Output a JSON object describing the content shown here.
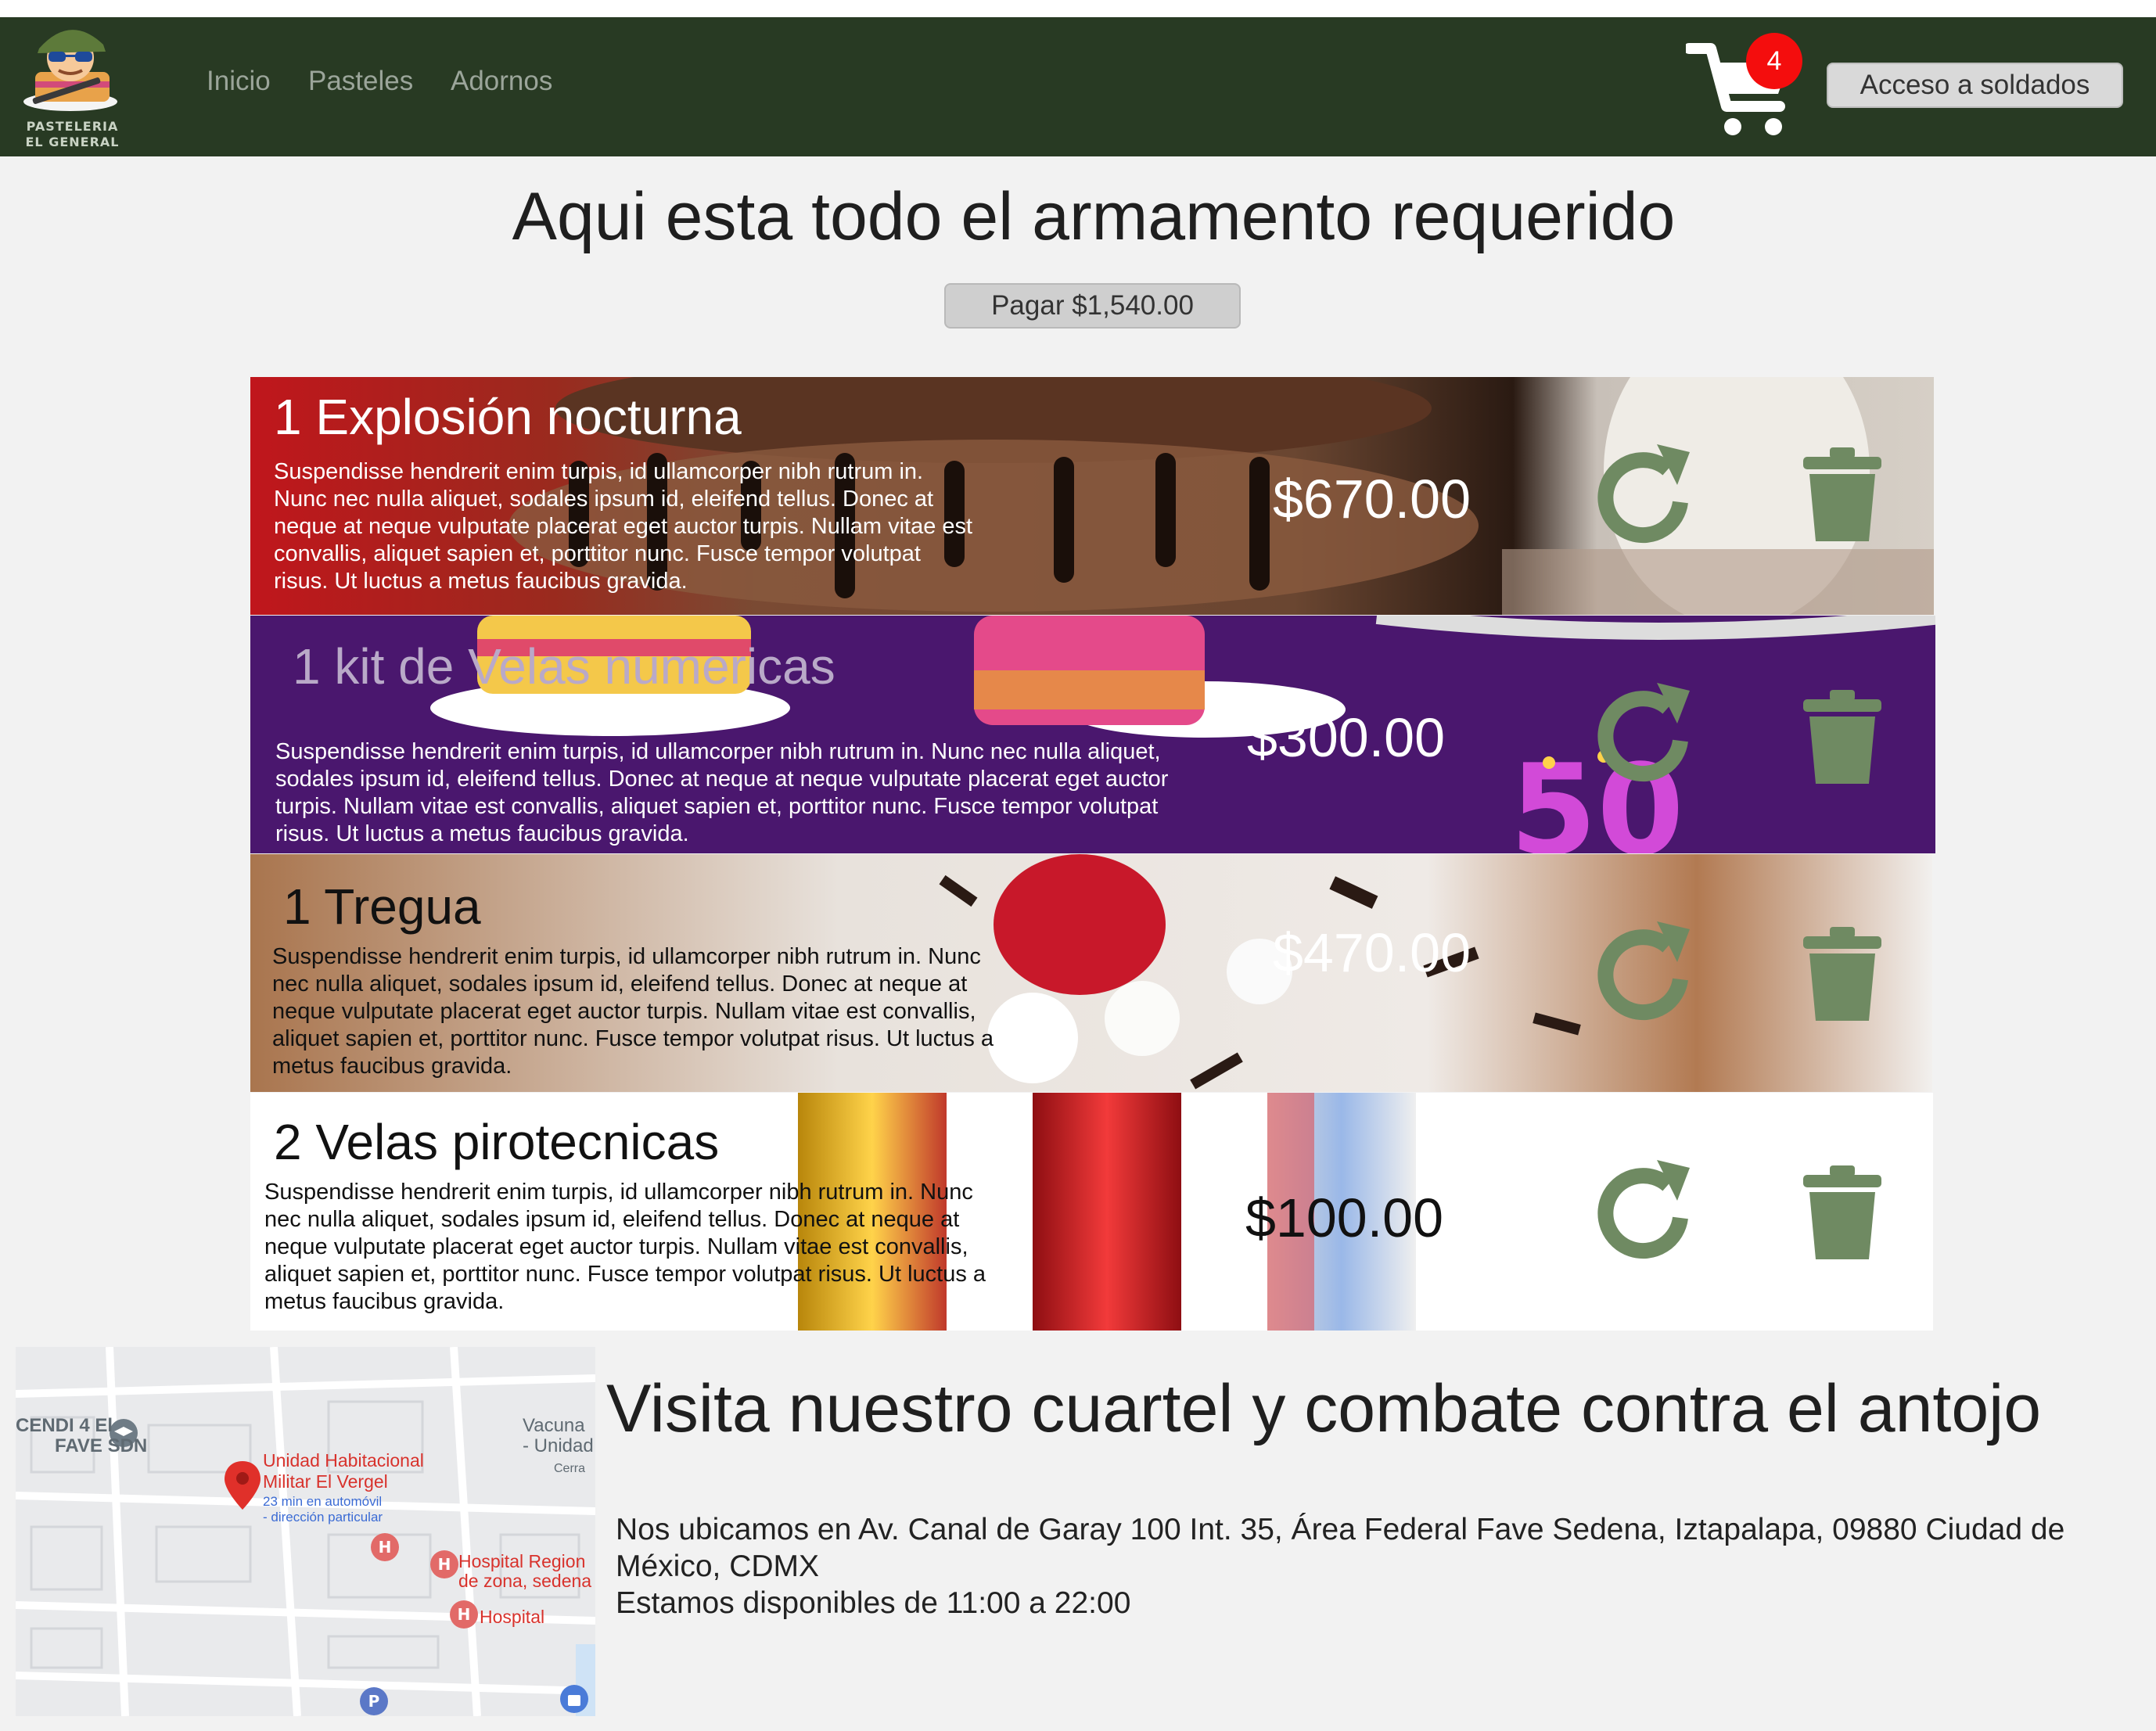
{
  "brand": {
    "name_line1": "PASTELERIA",
    "name_line2": "EL GENERAL",
    "logo_icon": "soldier-cake-logo"
  },
  "nav": {
    "links": [
      "Inicio",
      "Pasteles",
      "Adornos"
    ],
    "cart_icon": "shopping-cart-icon",
    "cart_count": "4",
    "login_label": "Acceso a soldados"
  },
  "cart_page": {
    "title": "Aqui esta todo el armamento requerido",
    "pay_label": "Pagar $1,540.00",
    "items": [
      {
        "name": "1 Explosión nocturna",
        "description": "Suspendisse hendrerit enim turpis, id ullamcorper nibh rutrum in. Nunc nec nulla aliquet, sodales ipsum id, eleifend tellus. Donec at neque at neque vulputate placerat eget auctor turpis. Nullam vitae est convallis, aliquet sapien et, porttitor nunc. Fusce tempor volutpat risus. Ut luctus a metus faucibus gravida.",
        "price": "$670.00",
        "image": "chocolate-cake-photo"
      },
      {
        "name": "1 kit de Velas numericas",
        "description": "Suspendisse hendrerit enim turpis, id ullamcorper nibh rutrum in. Nunc nec nulla aliquet, sodales ipsum id, eleifend tellus. Donec at neque at neque vulputate placerat eget auctor turpis. Nullam vitae est convallis, aliquet sapien et, porttitor nunc. Fusce tempor volutpat risus. Ut luctus a metus faucibus gravida.",
        "price": "$300.00",
        "image": "number-candles-illustration"
      },
      {
        "name": "1 Tregua",
        "description": "Suspendisse hendrerit enim turpis, id ullamcorper nibh rutrum in. Nunc nec nulla aliquet, sodales ipsum id, eleifend tellus. Donec at neque at neque vulputate placerat eget auctor turpis. Nullam vitae est convallis, aliquet sapien et, porttitor nunc. Fusce tempor volutpat risus. Ut luctus a metus faucibus gravida.",
        "price": "$470.00",
        "image": "strawberry-cream-cake-photo"
      },
      {
        "name": "2 Velas pirotecnicas",
        "description": "Suspendisse hendrerit enim turpis, id ullamcorper nibh rutrum in. Nunc nec nulla aliquet, sodales ipsum id, eleifend tellus. Donec at neque at neque vulputate placerat eget auctor turpis. Nullam vitae est convallis, aliquet sapien et, porttitor nunc. Fusce tempor volutpat risus. Ut luctus a metus faucibus gravida.",
        "price": "$100.00",
        "image": "sparkler-candles-photo"
      }
    ],
    "refresh_icon": "refresh-icon",
    "delete_icon": "trash-icon",
    "icon_color": "#6f8a62"
  },
  "location": {
    "title": "Visita nuestro cuartel y combate contra el antojo",
    "address": "Nos ubicamos en Av. Canal de Garay 100 Int. 35, Área Federal Fave Sedena, Iztapalapa, 09880 Ciudad de México, CDMX",
    "hours": "Estamos disponibles de 11:00 a 22:00",
    "map": {
      "place_name_line1": "Unidad Habitacional",
      "place_name_line2": "Militar El Vergel",
      "place_sub_line1": "23 min en automóvil",
      "place_sub_line2": "- dirección particular",
      "cendi_line1": "CENDI 4 El",
      "cendi_line2": "FAVE SDN",
      "vacuna_line1": "Vacuna",
      "vacuna_line2": "- Unidad",
      "vacuna_line3": "Cerra",
      "hospital_region_line1": "Hospital Region",
      "hospital_region_line2": "de zona, sedena",
      "hospital_label": "Hospital"
    }
  },
  "colors": {
    "navbar": "#283a23",
    "badge": "#f40d0d",
    "page_bg": "#f2f2f2"
  }
}
